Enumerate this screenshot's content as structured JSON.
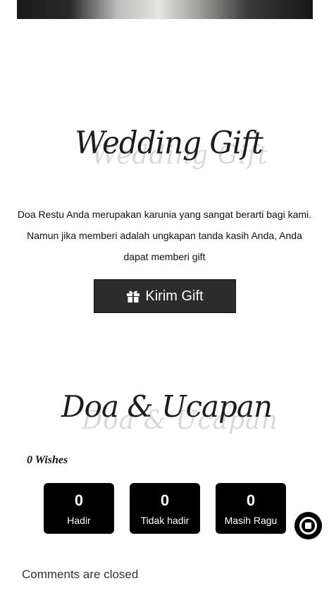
{
  "gift_section": {
    "title": "Wedding Gift",
    "title_shadow": "Wedding Gift",
    "text_line1": "Doa Restu Anda merupakan karunia yang sangat berarti bagi kami.",
    "text_line2": "Namun jika memberi adalah ungkapan tanda kasih Anda, Anda",
    "text_line3": "dapat memberi gift",
    "button_label": "Kirim Gift",
    "button_icon": "gift-icon"
  },
  "wishes_section": {
    "title": "Doa & Ucapan",
    "title_shadow": "Doa & Ucapan",
    "wish_count": "0 Wishes",
    "stats": [
      {
        "value": "0",
        "label": "Hadir"
      },
      {
        "value": "0",
        "label": "Tidak hadir"
      },
      {
        "value": "0",
        "label": "Masih Ragu"
      }
    ],
    "comments_status": "Comments are closed"
  },
  "audio_control": {
    "icon": "stop-icon"
  },
  "colors": {
    "accent": "#000000",
    "button_bg": "#2c2c2c",
    "page_bg": "#ffffff"
  }
}
